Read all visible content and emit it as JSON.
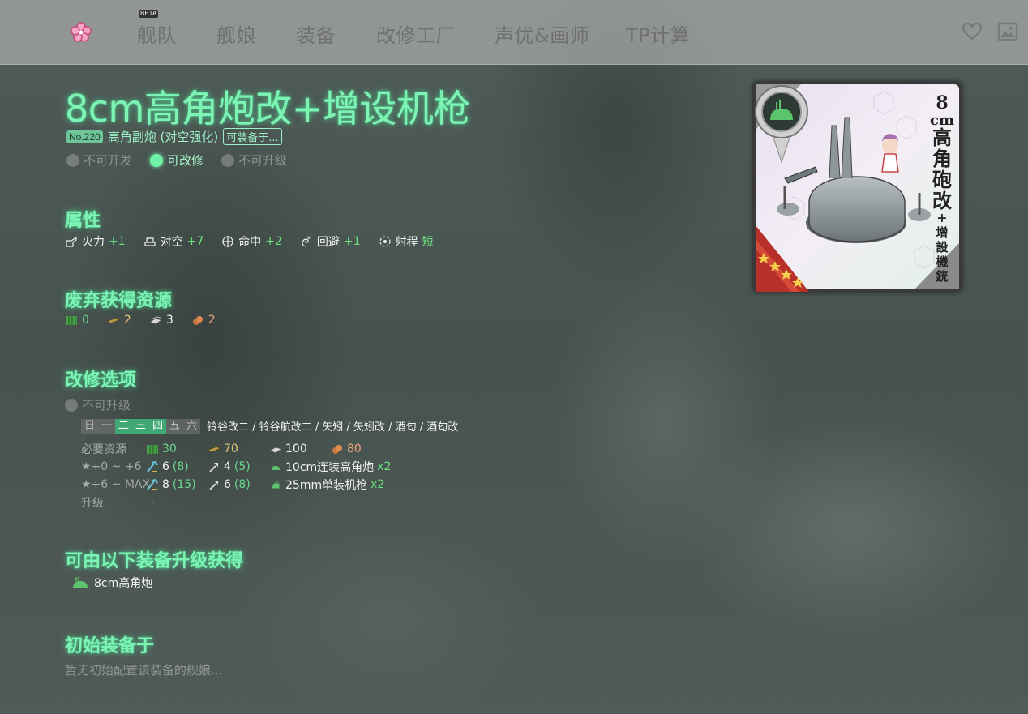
{
  "nav": {
    "items": [
      "舰队",
      "舰娘",
      "装备",
      "改修工厂",
      "声优&画师",
      "TP计算"
    ],
    "beta": "BETA"
  },
  "equip": {
    "name": "8cm高角炮改+增设机枪",
    "no": "No.220",
    "type": "高角副炮 (对空强化)",
    "equip_btn": "可装备于...",
    "status": [
      "不可开发",
      "可改修",
      "不可升级"
    ]
  },
  "stats": {
    "heading": "属性",
    "items": [
      {
        "label": "火力",
        "value": "+1"
      },
      {
        "label": "对空",
        "value": "+7"
      },
      {
        "label": "命中",
        "value": "+2"
      },
      {
        "label": "回避",
        "value": "+1"
      },
      {
        "label": "射程",
        "value": "短"
      }
    ]
  },
  "scrap": {
    "heading": "废弃获得资源",
    "values": [
      "0",
      "2",
      "3",
      "2"
    ]
  },
  "improve": {
    "heading": "改修选项",
    "upgrade_status": "不可升级",
    "days": [
      "日",
      "一",
      "二",
      "三",
      "四",
      "五",
      "六"
    ],
    "days_on": [
      false,
      false,
      true,
      true,
      true,
      false,
      false
    ],
    "ships": "铃谷改二 / 铃谷航改二 / 矢矧 / 矢矧改 / 酒匂 / 酒匂改",
    "req_label": "必要资源",
    "req_values": [
      "30",
      "70",
      "100",
      "80"
    ],
    "stage1": {
      "label": "★+0 ~ +6",
      "dev": "6",
      "dev_sure": "(8)",
      "screw": "4",
      "screw_sure": "(5)",
      "item": "10cm连装高角炮",
      "count": "x2"
    },
    "stage2": {
      "label": "★+6 ~ MAX",
      "dev": "8",
      "dev_sure": "(15)",
      "screw": "6",
      "screw_sure": "(8)",
      "item": "25mm单装机枪",
      "count": "x2"
    },
    "upgrade_label": "升级",
    "upgrade_value": "-"
  },
  "upgrade_from": {
    "heading": "可由以下装备升级获得",
    "item": "8cm高角炮"
  },
  "initial": {
    "heading": "初始装备于",
    "empty": "暂无初始配置该装备的舰娘..."
  },
  "card_text": {
    "top": "8",
    "unit": "cm",
    "lines": [
      "高",
      "角",
      "砲",
      "改"
    ],
    "plus": "+",
    "small": [
      "增",
      "設",
      "機",
      "銃"
    ]
  },
  "colors": {
    "accent": "#7df3b4",
    "plus": "#6be17e",
    "day_on": "#3fa874"
  }
}
